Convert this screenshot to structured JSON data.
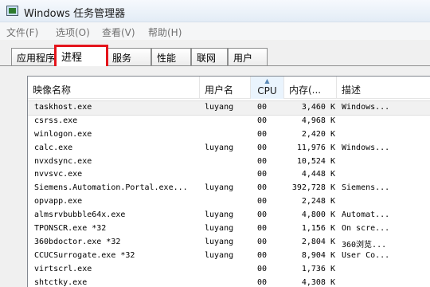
{
  "window": {
    "title": "Windows 任务管理器"
  },
  "menu": [
    "文件(F)",
    "选项(O)",
    "查看(V)",
    "帮助(H)"
  ],
  "tabs": [
    "应用程序",
    "进程",
    "服务",
    "性能",
    "联网",
    "用户"
  ],
  "active_tab_index": 1,
  "highlight_color": "#e4141b",
  "columns": [
    "映像名称",
    "用户名",
    "CPU",
    "内存(...",
    "描述"
  ],
  "sorted_column": "CPU",
  "processes": [
    {
      "name": "taskhost.exe",
      "user": "luyang",
      "cpu": "00",
      "mem": "3,460 K",
      "desc": "Windows..."
    },
    {
      "name": "csrss.exe",
      "user": "",
      "cpu": "00",
      "mem": "4,968 K",
      "desc": ""
    },
    {
      "name": "winlogon.exe",
      "user": "",
      "cpu": "00",
      "mem": "2,420 K",
      "desc": ""
    },
    {
      "name": "calc.exe",
      "user": "luyang",
      "cpu": "00",
      "mem": "11,976 K",
      "desc": "Windows..."
    },
    {
      "name": "nvxdsync.exe",
      "user": "",
      "cpu": "00",
      "mem": "10,524 K",
      "desc": ""
    },
    {
      "name": "nvvsvc.exe",
      "user": "",
      "cpu": "00",
      "mem": "4,448 K",
      "desc": ""
    },
    {
      "name": "Siemens.Automation.Portal.exe...",
      "user": "luyang",
      "cpu": "00",
      "mem": "392,728 K",
      "desc": "Siemens..."
    },
    {
      "name": "opvapp.exe",
      "user": "",
      "cpu": "00",
      "mem": "2,248 K",
      "desc": ""
    },
    {
      "name": "almsrvbubble64x.exe",
      "user": "luyang",
      "cpu": "00",
      "mem": "4,800 K",
      "desc": "Automat..."
    },
    {
      "name": "TPONSCR.exe *32",
      "user": "luyang",
      "cpu": "00",
      "mem": "1,156 K",
      "desc": "On scre..."
    },
    {
      "name": "360bdoctor.exe *32",
      "user": "luyang",
      "cpu": "00",
      "mem": "2,804 K",
      "desc": "360浏览..."
    },
    {
      "name": "CCUCSurrogate.exe *32",
      "user": "luyang",
      "cpu": "00",
      "mem": "8,904 K",
      "desc": "User Co..."
    },
    {
      "name": "virtscrl.exe",
      "user": "",
      "cpu": "00",
      "mem": "1,736 K",
      "desc": ""
    },
    {
      "name": "shtctky.exe",
      "user": "",
      "cpu": "00",
      "mem": "4,308 K",
      "desc": ""
    }
  ]
}
